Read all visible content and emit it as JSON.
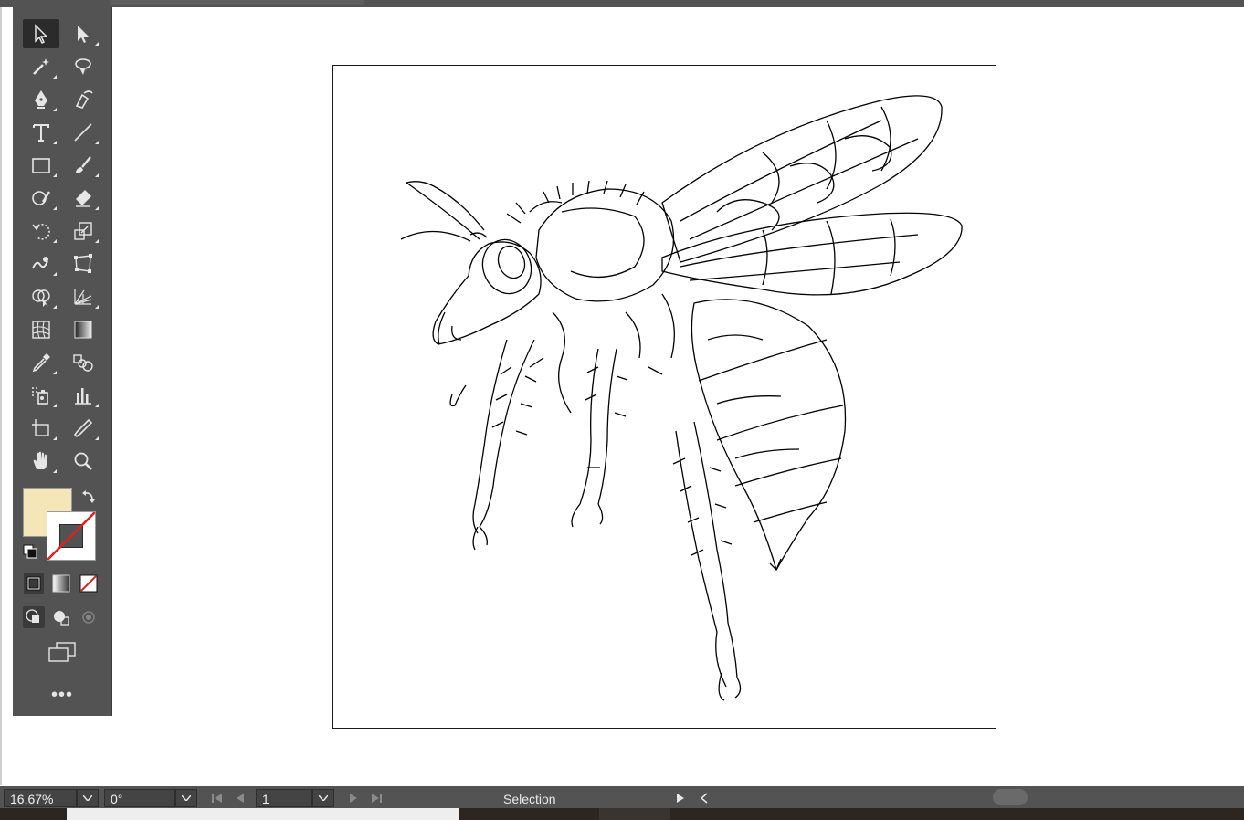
{
  "app": {
    "accent_active_tool": "#2b2b2b",
    "panel_color": "#535353"
  },
  "toolbar": {
    "tools": [
      {
        "name": "selection-tool-icon",
        "active": true
      },
      {
        "name": "direct-selection-tool-icon"
      },
      {
        "name": "magic-wand-tool-icon"
      },
      {
        "name": "lasso-tool-icon"
      },
      {
        "name": "pen-tool-icon"
      },
      {
        "name": "curvature-tool-icon"
      },
      {
        "name": "type-tool-icon"
      },
      {
        "name": "line-segment-tool-icon"
      },
      {
        "name": "rectangle-tool-icon"
      },
      {
        "name": "paintbrush-tool-icon"
      },
      {
        "name": "shaper-tool-icon"
      },
      {
        "name": "eraser-tool-icon"
      },
      {
        "name": "rotate-tool-icon"
      },
      {
        "name": "scale-tool-icon"
      },
      {
        "name": "warp-tool-icon"
      },
      {
        "name": "free-transform-tool-icon"
      },
      {
        "name": "shape-builder-tool-icon"
      },
      {
        "name": "perspective-grid-tool-icon"
      },
      {
        "name": "mesh-tool-icon"
      },
      {
        "name": "gradient-tool-icon"
      },
      {
        "name": "eyedropper-tool-icon"
      },
      {
        "name": "blend-tool-icon"
      },
      {
        "name": "symbol-sprayer-tool-icon"
      },
      {
        "name": "column-graph-tool-icon"
      },
      {
        "name": "artboard-tool-icon"
      },
      {
        "name": "slice-tool-icon"
      },
      {
        "name": "hand-tool-icon"
      },
      {
        "name": "zoom-tool-icon"
      }
    ],
    "fill_color": "#f5e6b8",
    "stroke_color": "none",
    "more_label": "•••"
  },
  "statusbar": {
    "zoom": "16.67%",
    "rotation": "0°",
    "artboard_number": "1",
    "status": "Selection"
  }
}
